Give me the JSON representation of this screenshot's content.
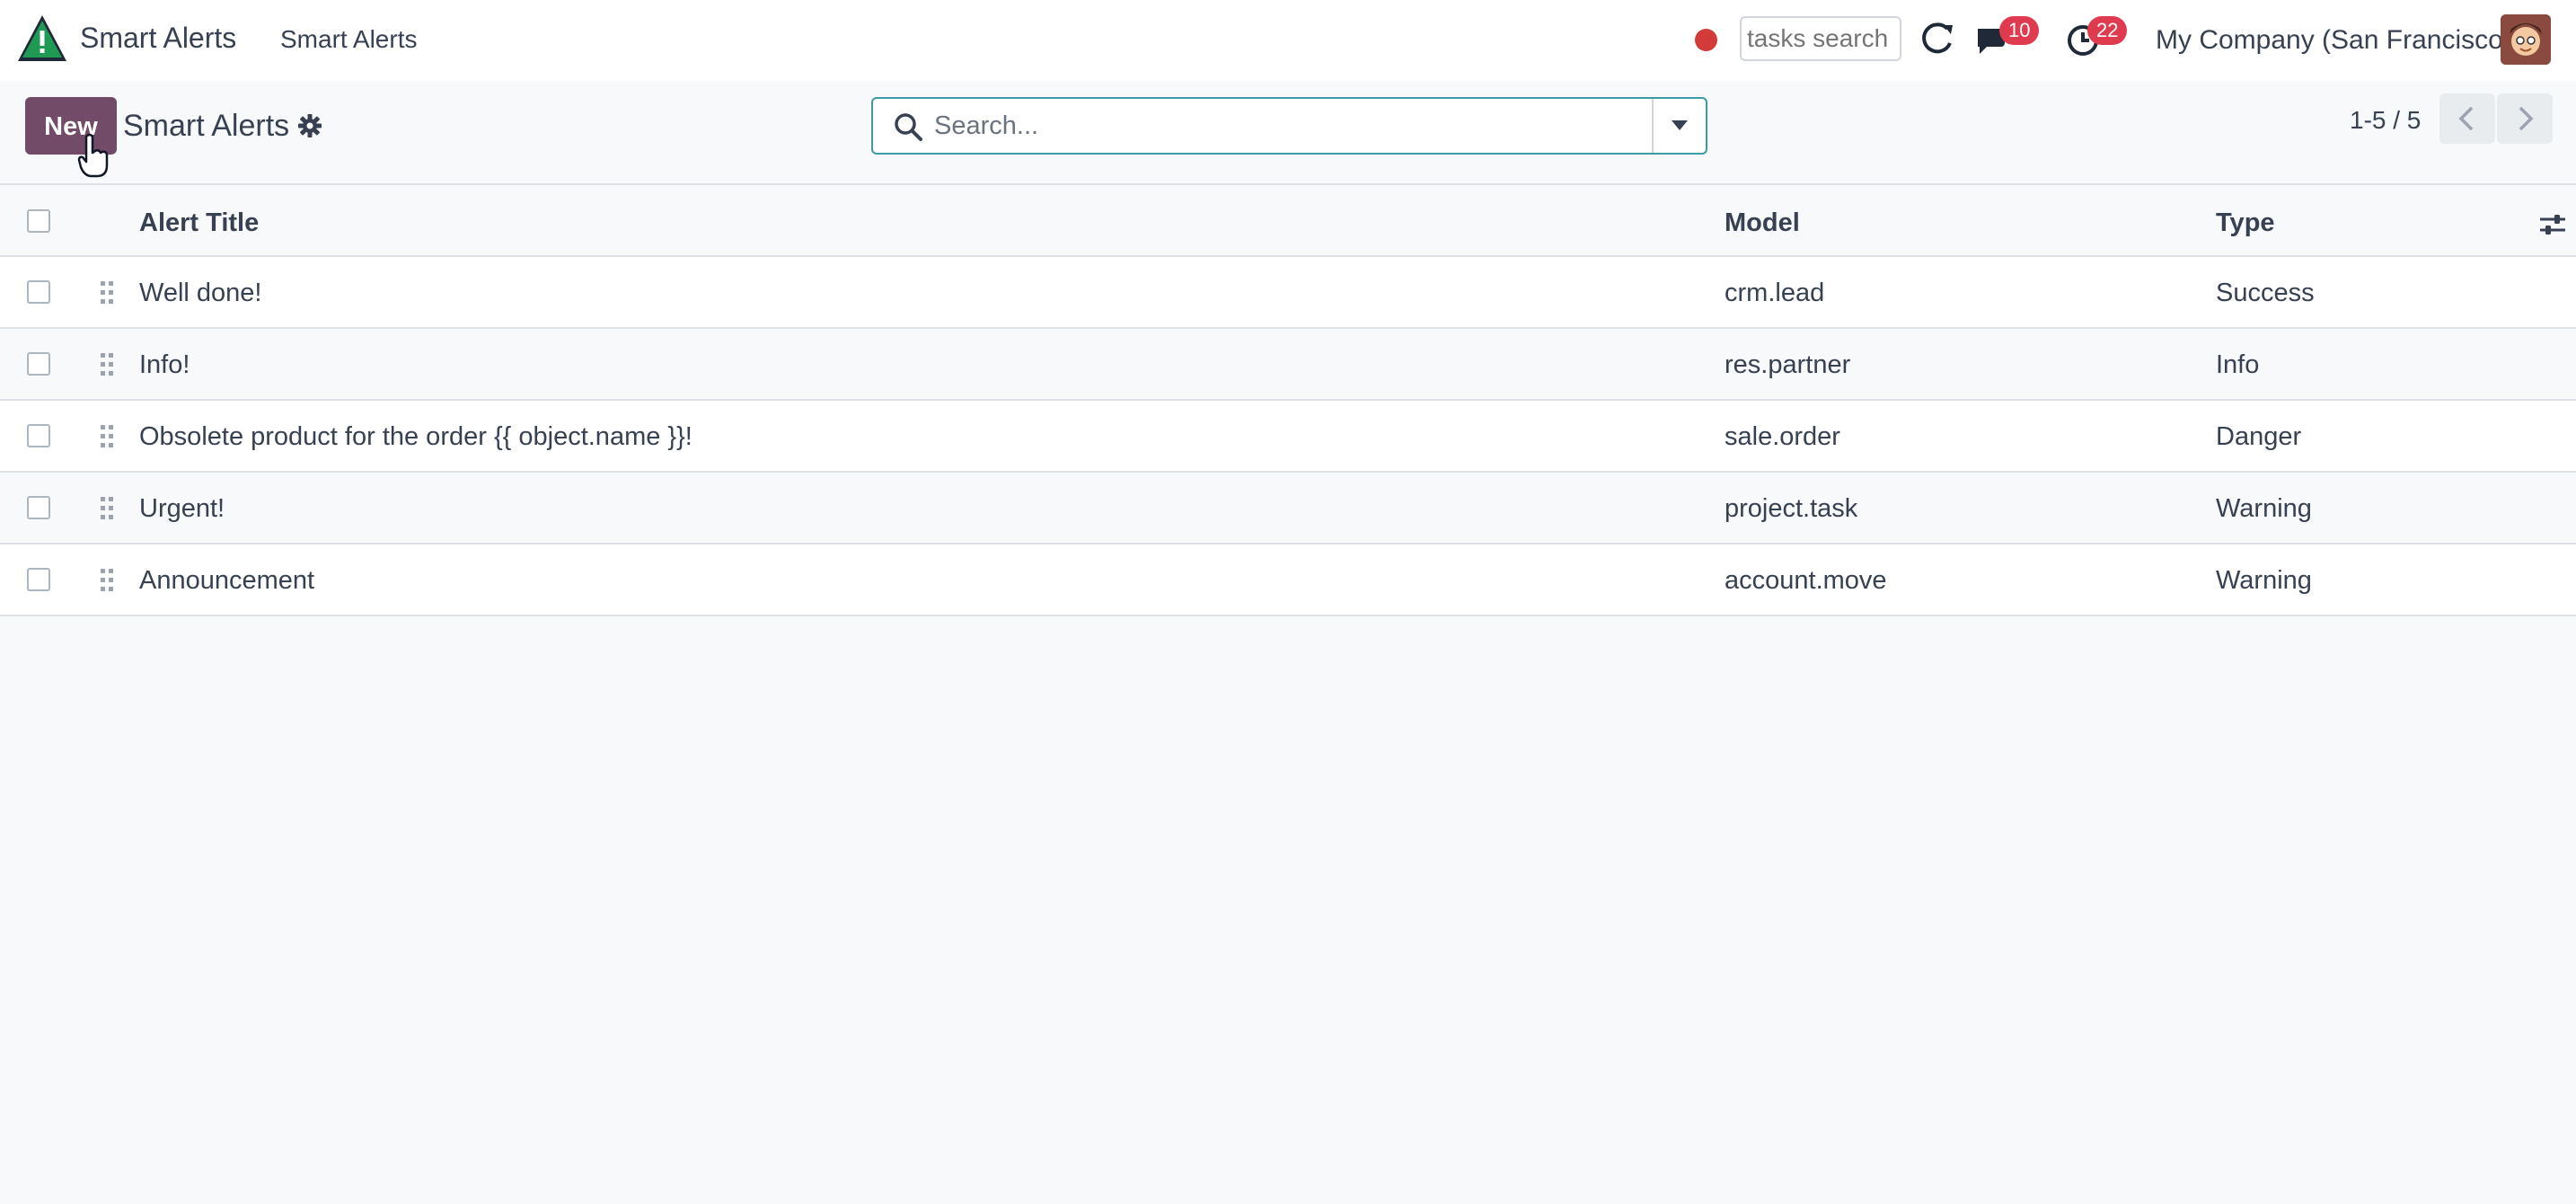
{
  "navbar": {
    "app_name": "Smart Alerts",
    "menu_item": "Smart Alerts",
    "tasks_search_placeholder": "tasks search",
    "messages_badge": "10",
    "activities_badge": "22",
    "company": "My Company (San Francisco)"
  },
  "control_panel": {
    "new_label": "New",
    "title": "Smart Alerts",
    "search_placeholder": "Search...",
    "pager": "1-5 / 5"
  },
  "list": {
    "columns": {
      "title": "Alert Title",
      "model": "Model",
      "type": "Type"
    },
    "rows": [
      {
        "title": "Well done!",
        "model": "crm.lead",
        "type": "Success"
      },
      {
        "title": "Info!",
        "model": "res.partner",
        "type": "Info"
      },
      {
        "title": "Obsolete product for the order {{ object.name }}!",
        "model": "sale.order",
        "type": "Danger"
      },
      {
        "title": "Urgent!",
        "model": "project.task",
        "type": "Warning"
      },
      {
        "title": "Announcement",
        "model": "account.move",
        "type": "Warning"
      }
    ]
  },
  "colors": {
    "brand": "#714b67",
    "search_border": "#3b9aa4",
    "badge": "#e03a4e",
    "record_dot": "#d33b3b"
  }
}
